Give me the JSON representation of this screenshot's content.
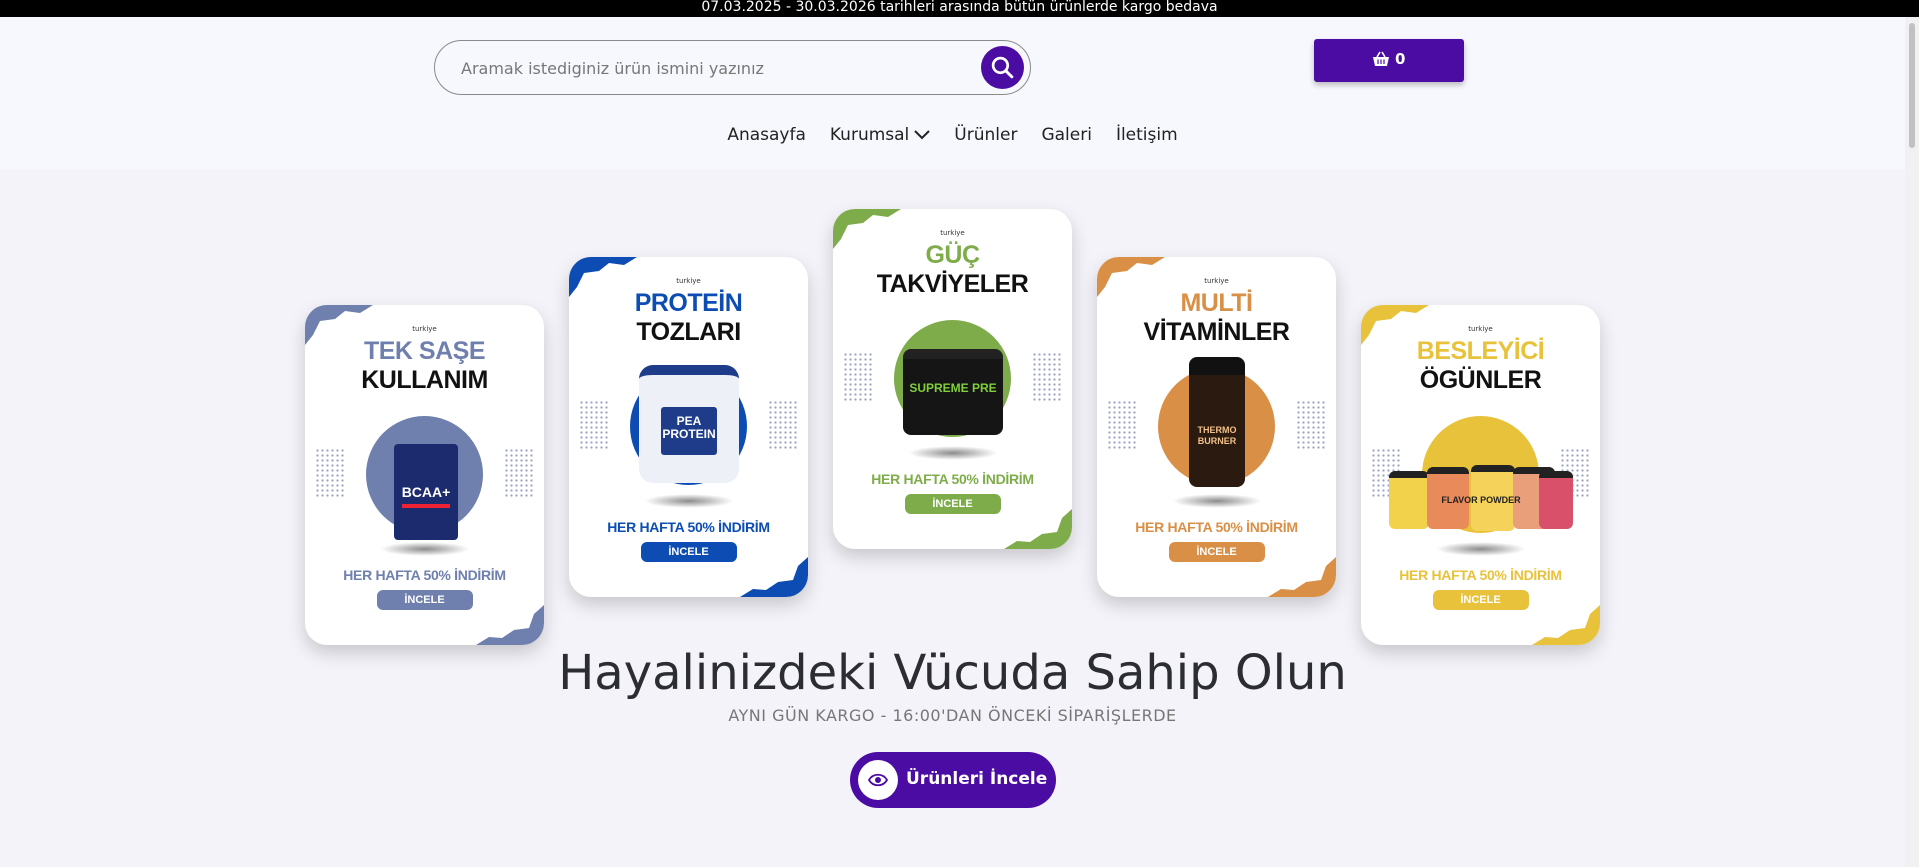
{
  "announcement": "07.03.2025 - 30.03.2026 tarihleri arasında bütün ürünlerde kargo bedava",
  "search": {
    "placeholder": "Aramak istediginiz ürün ismini yazınız",
    "icon": "search-icon"
  },
  "cart": {
    "count": "0",
    "icon": "basket-icon"
  },
  "nav": {
    "items": [
      {
        "label": "Anasayfa"
      },
      {
        "label": "Kurumsal",
        "icon": "chevron-down-icon"
      },
      {
        "label": "Ürünler"
      },
      {
        "label": "Galeri"
      },
      {
        "label": "İletişim"
      }
    ]
  },
  "cards": [
    {
      "brand": "turkiye",
      "line1": "TEK SAŞE",
      "line2": "KULLANIM",
      "product": "BCAA+",
      "promo": "HER HAFTA 50% İNDİRİM",
      "button": "İNCELE",
      "color": "#6f7fae"
    },
    {
      "brand": "turkiye",
      "line1": "PROTEİN",
      "line2": "TOZLARI",
      "product": "PEA PROTEIN",
      "promo": "HER HAFTA 50% İNDİRİM",
      "button": "İNCELE",
      "color": "#0d4db3"
    },
    {
      "brand": "turkiye",
      "line1": "GÜÇ",
      "line2": "TAKVİYELER",
      "product": "SUPREME PRE",
      "promo": "HER HAFTA 50% İNDİRİM",
      "button": "İNCELE",
      "color": "#7fac4b"
    },
    {
      "brand": "turkiye",
      "line1": "MULTİ",
      "line2": "VİTAMİNLER",
      "product": "THERMO BURNER",
      "promo": "HER HAFTA 50% İNDİRİM",
      "button": "İNCELE",
      "color": "#d98f45"
    },
    {
      "brand": "turkiye",
      "line1": "BESLEYİCİ",
      "line2": "ÖGÜNLER",
      "product": "FLAVOR POWDER",
      "promo": "HER HAFTA 50% İNDİRİM",
      "button": "İNCELE",
      "color": "#e8c23a"
    }
  ],
  "hero": {
    "title": "Hayalinizdeki Vücuda Sahip Olun",
    "subtitle": "AYNI GÜN KARGO - 16:00'DAN ÖNCEKİ SİPARİŞLERDE",
    "button": "Ürünleri İncele",
    "button_icon": "eye-icon"
  },
  "colors": {
    "accent": "#4b0ca3",
    "topbar": "#000000"
  }
}
